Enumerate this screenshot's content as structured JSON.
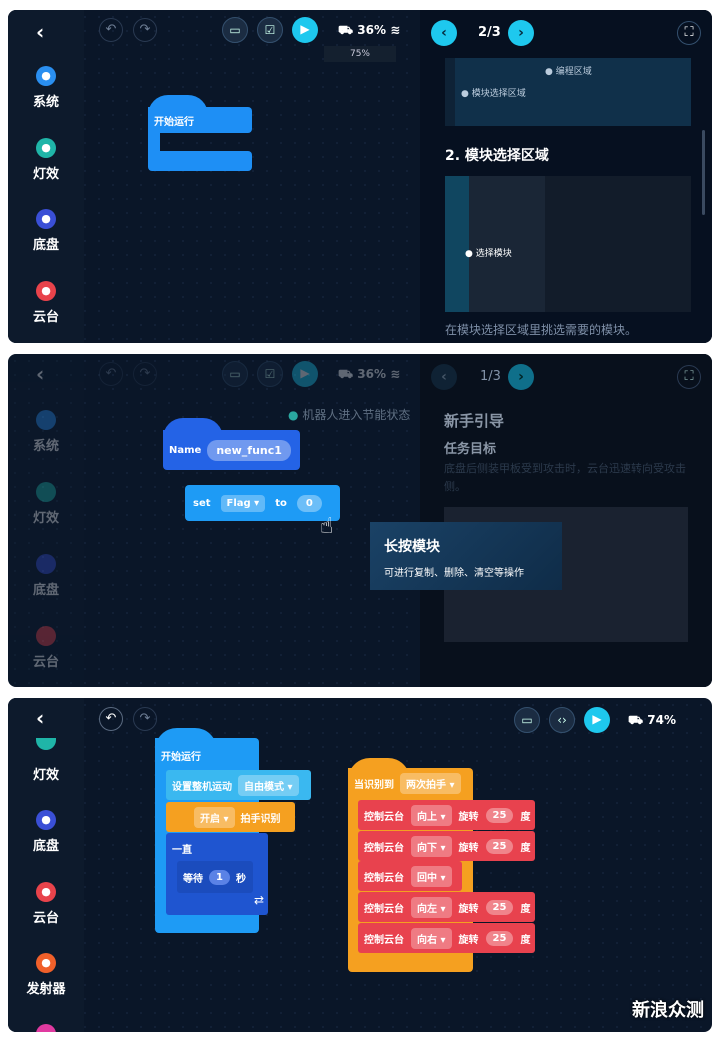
{
  "panel1": {
    "sidebar": [
      {
        "label": "系统",
        "color": "#2a8ff0"
      },
      {
        "label": "灯效",
        "color": "#1fb5a8"
      },
      {
        "label": "底盘",
        "color": "#3a4fd6"
      },
      {
        "label": "云台",
        "color": "#e8434b"
      }
    ],
    "battery": "36%",
    "zoom": "75%",
    "page": "2/3",
    "start_block": "开始运行",
    "guide": {
      "label_prog": "编程区域",
      "label_module": "模块选择区域",
      "heading": "2. 模块选择区域",
      "inner_label": "选择模块",
      "caption": "在模块选择区域里挑选需要的模块。"
    }
  },
  "panel2": {
    "sidebar": [
      "系统",
      "灯效",
      "底盘",
      "云台"
    ],
    "battery": "36%",
    "page": "1/3",
    "status": "机器人进入节能状态",
    "guide": {
      "title": "新手引导",
      "subtitle": "任务目标",
      "desc": "底盘后侧装甲板受到攻击时，云台迅速转向受攻击侧。"
    },
    "name_block": {
      "label": "Name",
      "value": "new_func1"
    },
    "set_block": {
      "set": "set",
      "var": "Flag",
      "to": "to",
      "value": "0"
    },
    "tooltip": {
      "title": "长按模块",
      "body": "可进行复制、删除、清空等操作"
    }
  },
  "panel3": {
    "sidebar": [
      {
        "label": "灯效",
        "color": "#1fb5a8"
      },
      {
        "label": "底盘",
        "color": "#3a4fd6"
      },
      {
        "label": "云台",
        "color": "#e8434b"
      },
      {
        "label": "发射器",
        "color": "#f0602a"
      }
    ],
    "battery": "74%",
    "start": {
      "title": "开始运行",
      "set_motion": "设置整机运动",
      "mode": "自由模式",
      "toggle": "开启",
      "clap": "拍手识别",
      "loop": "一直",
      "wait": "等待",
      "wait_val": "1",
      "sec": "秒"
    },
    "event": {
      "title": "当识别到",
      "trigger": "两次拍手",
      "rows": [
        {
          "label": "控制云台",
          "dir": "向上",
          "rot": "旋转",
          "val": "25",
          "unit": "度"
        },
        {
          "label": "控制云台",
          "dir": "向下",
          "rot": "旋转",
          "val": "25",
          "unit": "度"
        },
        {
          "label": "控制云台",
          "dir": "回中"
        },
        {
          "label": "控制云台",
          "dir": "向左",
          "rot": "旋转",
          "val": "25",
          "unit": "度"
        },
        {
          "label": "控制云台",
          "dir": "向右",
          "rot": "旋转",
          "val": "25",
          "unit": "度"
        }
      ]
    }
  },
  "watermark": "新浪众测"
}
